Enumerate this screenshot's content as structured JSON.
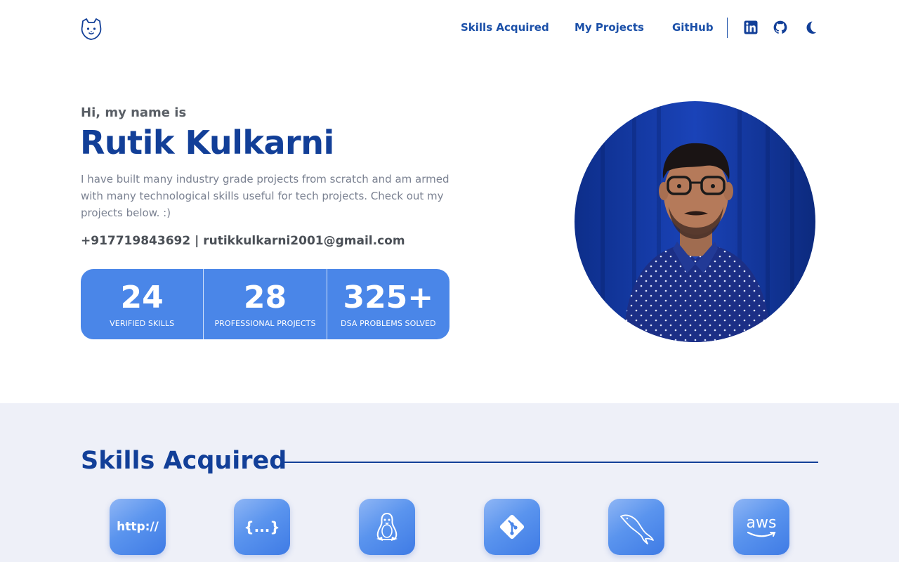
{
  "nav": {
    "links": [
      "Skills Acquired",
      "My Projects",
      "GitHub"
    ],
    "icons": [
      "linkedin-icon",
      "github-icon",
      "moon-icon"
    ],
    "logo": "bear-logo-icon"
  },
  "hero": {
    "greeting": "Hi, my name is",
    "name": "Rutik Kulkarni",
    "description": "I have built many industry grade projects from scratch and am armed with many technological skills useful for tech projects. Check out my projects below. :)",
    "contact": "+917719843692 | rutikkulkarni2001@gmail.com",
    "stats": [
      {
        "value": "24",
        "label": "VERIFIED SKILLS"
      },
      {
        "value": "28",
        "label": "PROFESSIONAL PROJECTS"
      },
      {
        "value": "325+",
        "label": "DSA PROBLEMS SOLVED"
      }
    ]
  },
  "skills": {
    "title": "Skills Acquired",
    "items": [
      {
        "icon": "http-icon",
        "text": "http://"
      },
      {
        "icon": "json-icon",
        "text": "{...}"
      },
      {
        "icon": "linux-icon",
        "text": ""
      },
      {
        "icon": "git-icon",
        "text": ""
      },
      {
        "icon": "mysql-icon",
        "text": ""
      },
      {
        "icon": "aws-icon",
        "text": "aws"
      }
    ]
  },
  "colors": {
    "primary": "#123f98",
    "accent": "#4a86e8",
    "section_bg": "#eef0f8"
  }
}
